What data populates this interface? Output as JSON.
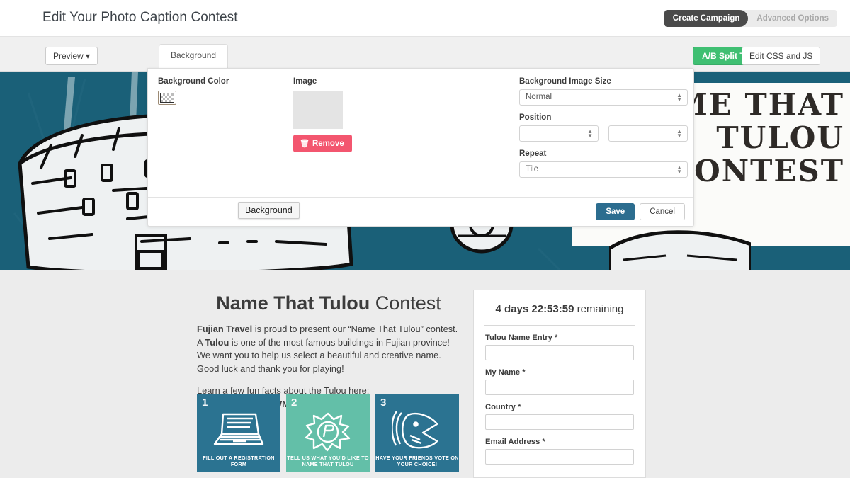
{
  "header": {
    "title": "Edit Your Photo Caption Contest",
    "mode_active": "Create Campaign",
    "mode_inactive": "Advanced Options"
  },
  "toolbar": {
    "preview_label": "Preview ▾",
    "split_test_label": "A/B Split Test",
    "edit_css_label": "Edit CSS and JS"
  },
  "modal": {
    "tab_label": "Background",
    "background_color_label": "Background Color",
    "image_label": "Image",
    "remove_label": "Remove",
    "remove_icon": "trash-icon",
    "bg_size_label": "Background Image Size",
    "bg_size_value": "Normal",
    "position_label": "Position",
    "position_value_x": "",
    "position_value_y": "",
    "repeat_label": "Repeat",
    "repeat_value": "Tile",
    "hint_pill": "Background",
    "save_label": "Save",
    "cancel_label": "Cancel"
  },
  "banner": {
    "line1": "ME THAT",
    "line2": "TULOU",
    "line3": "CONTEST",
    "bg_color": "#1a6078"
  },
  "preview": {
    "title_bold": "Name That Tulou",
    "title_rest": " Contest",
    "paragraph1_a": "Fujian Travel",
    "paragraph1_b": " is proud to present our “Name That Tulou” contest. A ",
    "paragraph1_c": "Tulou",
    "paragraph1_d": " is one of the most famous buildings in Fujian province! We want you to help us select a beautiful and creative name. Good luck and thank you for playing!",
    "paragraph2_a": "Learn a few fun facts about the Tulou here: ",
    "paragraph2_link": "http://on.fb.me/1VWMJnT",
    "steps": [
      {
        "num": "1",
        "caption": "Fill out a registration form",
        "color": "#2b7391",
        "icon": "laptop-icon"
      },
      {
        "num": "2",
        "caption": "Tell us what you’d like to name that Tulou",
        "color": "#63bfa8",
        "icon": "splat-icon"
      },
      {
        "num": "3",
        "caption": "Have your friends vote on your choice!",
        "color": "#2b7391",
        "icon": "megaphone-icon"
      }
    ]
  },
  "entry_form": {
    "countdown_value": "4 days 22:53:59",
    "countdown_suffix": " remaining",
    "fields": [
      {
        "label": "Tulou Name Entry *",
        "value": ""
      },
      {
        "label": "My Name *",
        "value": ""
      },
      {
        "label": "Country *",
        "value": ""
      },
      {
        "label": "Email Address *",
        "value": ""
      }
    ]
  }
}
